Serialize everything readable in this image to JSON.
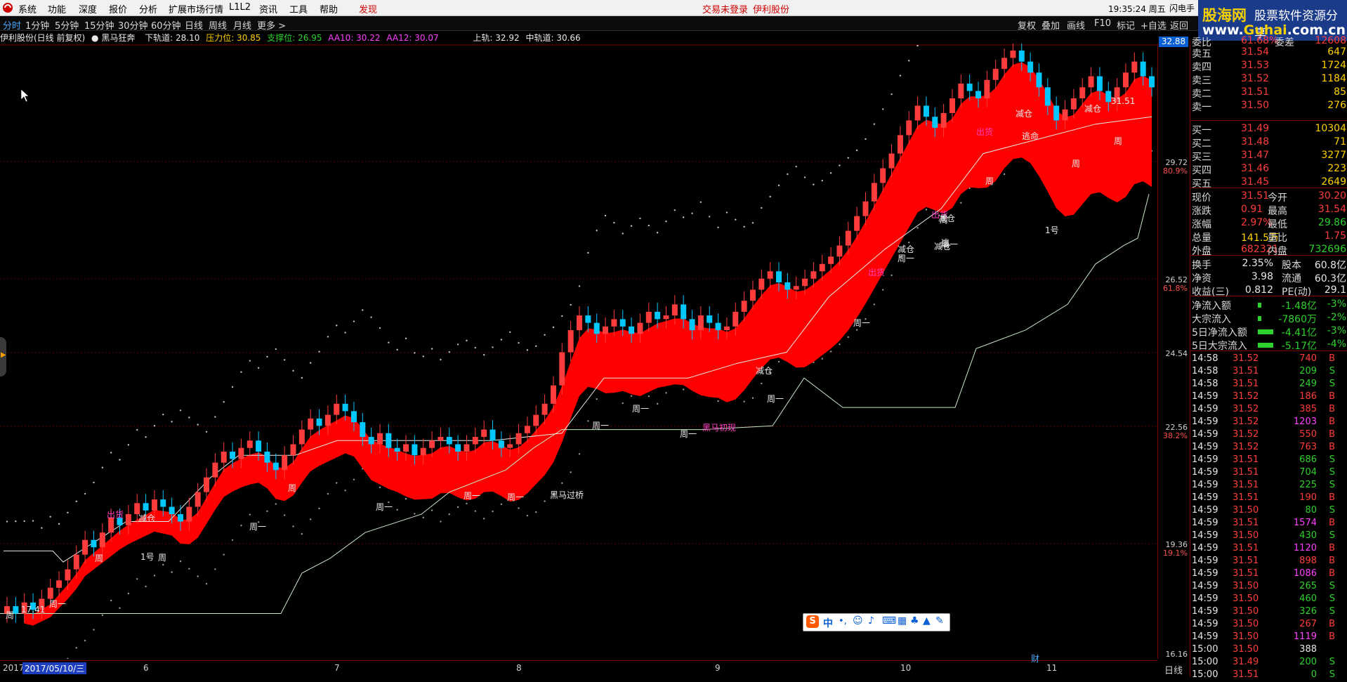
{
  "menu": {
    "items": [
      "系统",
      "功能",
      "深度",
      "报价",
      "分析",
      "扩展市场行情",
      "L1L2",
      "资讯",
      "工具",
      "帮助"
    ],
    "highlight": "发现",
    "status": [
      "交易未登录",
      "伊利股份"
    ],
    "clock": "19:35:24 周五",
    "window_title": "闪电手"
  },
  "brand": {
    "cn": "股海网",
    "slogan": "股票软件资源分享",
    "url_pre": "www.",
    "url_main": "Guhai",
    "url_post": ".com.cn"
  },
  "periods": [
    "分时",
    "1分钟",
    "5分钟",
    "15分钟",
    "30分钟",
    "60分钟",
    "日线",
    "周线",
    "月线",
    "更多 >"
  ],
  "active_period": "分时",
  "toolbar": [
    "复权",
    "叠加",
    "画线",
    "F10",
    "标记",
    "+自选",
    "返回"
  ],
  "indicator": {
    "stock": "伊利股份(日线 前复权)",
    "formula": "黑马狂奔",
    "lower": "下轨道: 28.10",
    "pressure": "压力位: 30.85",
    "support": "支撑位: 26.95",
    "aa10": "AA10: 30.22",
    "aa12": "AA12: 30.07",
    "upper": "上轨: 32.92",
    "middle": "中轨道: 30.66"
  },
  "price_axis": {
    "current": "32.88",
    "ticks": [
      {
        "v": "29.72",
        "r": "80.9%"
      },
      {
        "v": "26.52",
        "r": "61.8%"
      },
      {
        "v": "24.54",
        "r": ""
      },
      {
        "v": "22.56",
        "r": "38.2%"
      },
      {
        "v": "19.36",
        "r": "19.1%"
      },
      {
        "v": "16.16",
        "r": ""
      }
    ]
  },
  "date_axis": {
    "start": "2017",
    "cursor": "2017/05/10/三",
    "months": [
      "6",
      "7",
      "8",
      "9",
      "10",
      "11"
    ],
    "foot": "财",
    "period": "日线"
  },
  "labels": {
    "chuhuo": "出货",
    "jiancang": "减仓",
    "zhou": "周",
    "zhouyi": "周一",
    "yihao": "1号",
    "taoming": "逃命",
    "tao": "逃",
    "heima_chuxian": "黑马初现",
    "heima_guoqiao": "黑马过桥",
    "price_last": "31.51",
    "price_1741": "17.41"
  },
  "book": {
    "webi": {
      "l": "委比",
      "p": "61.68%",
      "m": "委差",
      "v": "12608"
    },
    "sell": [
      {
        "l": "卖五",
        "p": "31.54",
        "v": "647"
      },
      {
        "l": "卖四",
        "p": "31.53",
        "v": "1724"
      },
      {
        "l": "卖三",
        "p": "31.52",
        "v": "1184"
      },
      {
        "l": "卖二",
        "p": "31.51",
        "v": "85"
      },
      {
        "l": "卖一",
        "p": "31.50",
        "v": "276"
      }
    ],
    "buy": [
      {
        "l": "买一",
        "p": "31.49",
        "v": "10304"
      },
      {
        "l": "买二",
        "p": "31.48",
        "v": "71"
      },
      {
        "l": "买三",
        "p": "31.47",
        "v": "3277"
      },
      {
        "l": "买四",
        "p": "31.46",
        "v": "223"
      },
      {
        "l": "买五",
        "p": "31.45",
        "v": "2649"
      }
    ]
  },
  "quote": [
    {
      "l": "现价",
      "a": "31.51",
      "b": "今开",
      "c": "30.20",
      "ac": "red",
      "cc": "red"
    },
    {
      "l": "涨跌",
      "a": "0.91",
      "b": "最高",
      "c": "31.54",
      "ac": "red",
      "cc": "red"
    },
    {
      "l": "涨幅",
      "a": "2.97%",
      "b": "最低",
      "c": "29.86",
      "ac": "red",
      "cc": "grn"
    },
    {
      "l": "总量",
      "a": "141.5万",
      "b": "量比",
      "c": "1.75",
      "ac": "yel",
      "cc": "red"
    },
    {
      "l": "外盘",
      "a": "682321",
      "b": "内盘",
      "c": "732696",
      "ac": "red",
      "cc": "grn"
    }
  ],
  "fund": [
    {
      "l": "换手",
      "a": "2.35%",
      "b": "股本",
      "c": "60.8亿"
    },
    {
      "l": "净资",
      "a": "3.98",
      "b": "流通",
      "c": "60.3亿"
    },
    {
      "l": "收益(三)",
      "a": "0.812",
      "b": "PE(动)",
      "c": "29.1"
    }
  ],
  "flow": [
    {
      "l": "净流入额",
      "a": "-1.48亿",
      "c": "-3%"
    },
    {
      "l": "大宗流入",
      "a": "-7860万",
      "c": "-2%"
    },
    {
      "l": "5日净流入额",
      "a": "-4.41亿",
      "c": "-3%"
    },
    {
      "l": "5日大宗流入",
      "a": "-5.17亿",
      "c": "-4%"
    }
  ],
  "ticks": [
    {
      "t": "14:58",
      "p": "31.52",
      "v": "740",
      "d": "B"
    },
    {
      "t": "14:58",
      "p": "31.51",
      "v": "209",
      "d": "S"
    },
    {
      "t": "14:58",
      "p": "31.51",
      "v": "249",
      "d": "S"
    },
    {
      "t": "14:59",
      "p": "31.52",
      "v": "186",
      "d": "B"
    },
    {
      "t": "14:59",
      "p": "31.52",
      "v": "385",
      "d": "B"
    },
    {
      "t": "14:59",
      "p": "31.52",
      "v": "1203",
      "d": "B"
    },
    {
      "t": "14:59",
      "p": "31.52",
      "v": "550",
      "d": "B"
    },
    {
      "t": "14:59",
      "p": "31.52",
      "v": "763",
      "d": "B"
    },
    {
      "t": "14:59",
      "p": "31.51",
      "v": "686",
      "d": "S"
    },
    {
      "t": "14:59",
      "p": "31.51",
      "v": "704",
      "d": "S"
    },
    {
      "t": "14:59",
      "p": "31.51",
      "v": "225",
      "d": "S"
    },
    {
      "t": "14:59",
      "p": "31.51",
      "v": "190",
      "d": "B"
    },
    {
      "t": "14:59",
      "p": "31.50",
      "v": "80",
      "d": "S"
    },
    {
      "t": "14:59",
      "p": "31.51",
      "v": "1574",
      "d": "B"
    },
    {
      "t": "14:59",
      "p": "31.50",
      "v": "430",
      "d": "S"
    },
    {
      "t": "14:59",
      "p": "31.51",
      "v": "1120",
      "d": "B"
    },
    {
      "t": "14:59",
      "p": "31.51",
      "v": "898",
      "d": "B"
    },
    {
      "t": "14:59",
      "p": "31.51",
      "v": "1086",
      "d": "B"
    },
    {
      "t": "14:59",
      "p": "31.50",
      "v": "265",
      "d": "S"
    },
    {
      "t": "14:59",
      "p": "31.50",
      "v": "460",
      "d": "S"
    },
    {
      "t": "14:59",
      "p": "31.50",
      "v": "326",
      "d": "S"
    },
    {
      "t": "14:59",
      "p": "31.50",
      "v": "267",
      "d": "B"
    },
    {
      "t": "14:59",
      "p": "31.50",
      "v": "1119",
      "d": "B"
    },
    {
      "t": "15:00",
      "p": "31.50",
      "v": "388",
      "d": ""
    },
    {
      "t": "15:00",
      "p": "31.49",
      "v": "200",
      "d": "S"
    },
    {
      "t": "15:00",
      "p": "31.51",
      "v": "0",
      "d": "S"
    }
  ],
  "ime": {
    "label": "中"
  },
  "colors": {
    "up": "#ff3c3c",
    "down": "#00c8ff",
    "band": "#ff0000",
    "accent": "#1a3a8a"
  }
}
